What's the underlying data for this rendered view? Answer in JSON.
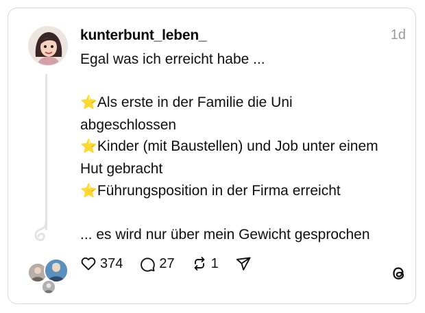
{
  "post": {
    "username": "kunterbunt_leben_",
    "time": "1d",
    "lines": [
      "Egal was ich erreicht habe ...",
      "",
      "⭐Als erste in der Familie die Uni",
      "abgeschlossen",
      "⭐Kinder (mit Baustellen) und Job unter einem",
      "Hut gebracht",
      "⭐Führungsposition in der Firma erreicht",
      "",
      "... es wird nur über mein Gewicht gesprochen"
    ]
  },
  "actions": {
    "likes": "374",
    "comments": "27",
    "reposts": "1"
  },
  "icons": {
    "like": "heart-icon",
    "comment": "comment-bubble-icon",
    "repost": "repost-arrows-icon",
    "share": "send-paper-plane-icon",
    "brand": "threads-logo-icon"
  },
  "colors": {
    "border": "#d9d9d9",
    "muted": "#999999",
    "star": "#f4b400"
  }
}
